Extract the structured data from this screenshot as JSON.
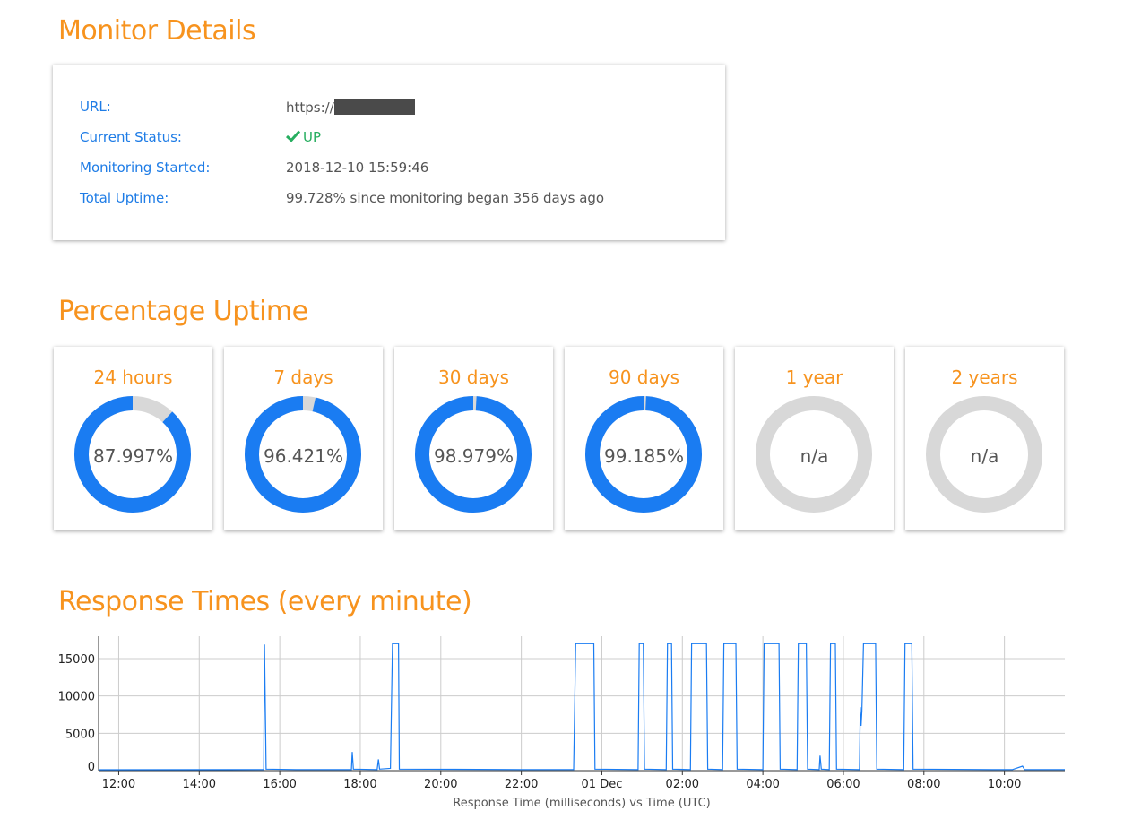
{
  "sections": {
    "monitor_title": "Monitor Details",
    "uptime_title": "Percentage Uptime",
    "response_title": "Response Times (every minute)"
  },
  "details": {
    "url_label": "URL:",
    "url_value": "https://",
    "status_label": "Current Status:",
    "status_value": "UP",
    "started_label": "Monitoring Started:",
    "started_value": "2018-12-10 15:59:46",
    "total_label": "Total Uptime:",
    "total_value": "99.728% since monitoring began 356 days ago"
  },
  "uptime": [
    {
      "period": "24 hours",
      "label": "87.997%",
      "value": 87.997
    },
    {
      "period": "7 days",
      "label": "96.421%",
      "value": 96.421
    },
    {
      "period": "30 days",
      "label": "98.979%",
      "value": 98.979
    },
    {
      "period": "90 days",
      "label": "99.185%",
      "value": 99.185
    },
    {
      "period": "1 year",
      "label": "n/a",
      "value": null
    },
    {
      "period": "2 years",
      "label": "n/a",
      "value": null
    }
  ],
  "colors": {
    "accent": "#f7931e",
    "link": "#1e7ce6",
    "ring_fill": "#1a7cf2",
    "ring_track": "#d8d8d8",
    "status_up": "#27ae60",
    "line": "#1a7cf2"
  },
  "chart_data": {
    "type": "line",
    "xlabel": "Response Time (milliseconds) vs Time (UTC)",
    "ylabel": "",
    "ylim": [
      0,
      18000
    ],
    "xlim_hours": [
      11.5,
      35.5
    ],
    "x_ticks": [
      {
        "hour": 12,
        "label": "12:00"
      },
      {
        "hour": 14,
        "label": "14:00"
      },
      {
        "hour": 16,
        "label": "16:00"
      },
      {
        "hour": 18,
        "label": "18:00"
      },
      {
        "hour": 20,
        "label": "20:00"
      },
      {
        "hour": 22,
        "label": "22:00"
      },
      {
        "hour": 24,
        "label": "01 Dec"
      },
      {
        "hour": 26,
        "label": "02:00"
      },
      {
        "hour": 28,
        "label": "04:00"
      },
      {
        "hour": 30,
        "label": "06:00"
      },
      {
        "hour": 32,
        "label": "08:00"
      },
      {
        "hour": 34,
        "label": "10:00"
      }
    ],
    "y_ticks": [
      {
        "value": 0,
        "label": "0"
      },
      {
        "value": 5000,
        "label": "5000"
      },
      {
        "value": 10000,
        "label": "10000"
      },
      {
        "value": 15000,
        "label": "15000"
      }
    ],
    "grid": true,
    "series": [
      {
        "points": [
          [
            11.5,
            120
          ],
          [
            15.6,
            150
          ],
          [
            15.62,
            16900
          ],
          [
            15.66,
            200
          ],
          [
            16.4,
            150
          ],
          [
            17.78,
            150
          ],
          [
            17.8,
            2500
          ],
          [
            17.83,
            200
          ],
          [
            18.42,
            150
          ],
          [
            18.45,
            1500
          ],
          [
            18.48,
            200
          ],
          [
            18.75,
            300
          ],
          [
            18.8,
            17000
          ],
          [
            18.95,
            17000
          ],
          [
            18.97,
            200
          ],
          [
            22.0,
            150
          ],
          [
            23.3,
            150
          ],
          [
            23.35,
            17000
          ],
          [
            23.8,
            17000
          ],
          [
            23.83,
            200
          ],
          [
            24.9,
            150
          ],
          [
            24.93,
            17000
          ],
          [
            25.03,
            17000
          ],
          [
            25.06,
            200
          ],
          [
            25.6,
            150
          ],
          [
            25.63,
            17000
          ],
          [
            25.73,
            17000
          ],
          [
            25.76,
            200
          ],
          [
            26.2,
            150
          ],
          [
            26.23,
            17000
          ],
          [
            26.6,
            17000
          ],
          [
            26.63,
            200
          ],
          [
            27.0,
            150
          ],
          [
            27.03,
            17000
          ],
          [
            27.33,
            17000
          ],
          [
            27.36,
            200
          ],
          [
            28.0,
            150
          ],
          [
            28.03,
            17000
          ],
          [
            28.4,
            17000
          ],
          [
            28.43,
            200
          ],
          [
            28.85,
            150
          ],
          [
            28.88,
            17000
          ],
          [
            29.08,
            17000
          ],
          [
            29.11,
            200
          ],
          [
            29.4,
            150
          ],
          [
            29.42,
            2000
          ],
          [
            29.45,
            200
          ],
          [
            29.65,
            150
          ],
          [
            29.68,
            17000
          ],
          [
            29.8,
            17000
          ],
          [
            29.83,
            200
          ],
          [
            30.4,
            150
          ],
          [
            30.42,
            8500
          ],
          [
            30.44,
            6000
          ],
          [
            30.46,
            8000
          ],
          [
            30.5,
            17000
          ],
          [
            30.8,
            17000
          ],
          [
            30.83,
            200
          ],
          [
            31.5,
            150
          ],
          [
            31.53,
            17000
          ],
          [
            31.7,
            17000
          ],
          [
            31.73,
            200
          ],
          [
            33.7,
            150
          ],
          [
            34.2,
            150
          ],
          [
            34.45,
            600
          ],
          [
            34.5,
            150
          ],
          [
            35.5,
            150
          ]
        ]
      }
    ]
  }
}
